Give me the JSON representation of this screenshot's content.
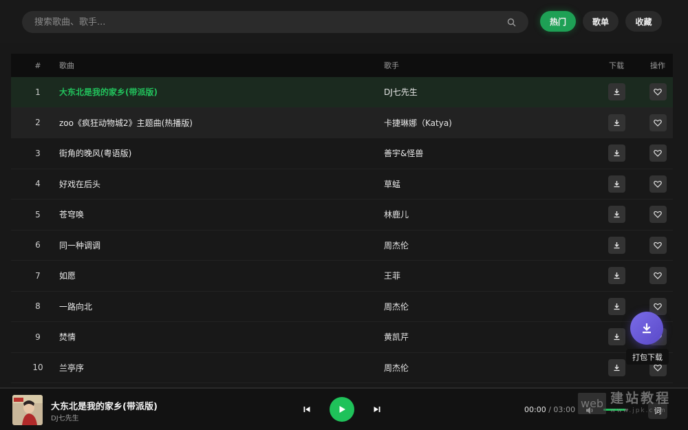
{
  "search": {
    "placeholder": "搜索歌曲、歌手..."
  },
  "tabs": [
    {
      "label": "热门",
      "active": true
    },
    {
      "label": "歌单",
      "active": false
    },
    {
      "label": "收藏",
      "active": false
    }
  ],
  "table": {
    "headers": {
      "num": "#",
      "title": "歌曲",
      "artist": "歌手",
      "download": "下载",
      "action": "操作"
    },
    "rows": [
      {
        "num": "1",
        "title": "大东北是我的家乡(带派版)",
        "artist": "DJ七先生"
      },
      {
        "num": "2",
        "title": "zoo《疯狂动物城2》主题曲(热播版)",
        "artist": "卡捷琳娜（Katya)"
      },
      {
        "num": "3",
        "title": "街角的晚风(粤语版)",
        "artist": "善宇&怪兽"
      },
      {
        "num": "4",
        "title": "好戏在后头",
        "artist": "草蜢"
      },
      {
        "num": "5",
        "title": "苍穹唤",
        "artist": "林鹿儿"
      },
      {
        "num": "6",
        "title": "同一种调调",
        "artist": "周杰伦"
      },
      {
        "num": "7",
        "title": "如愿",
        "artist": "王菲"
      },
      {
        "num": "8",
        "title": "一路向北",
        "artist": "周杰伦"
      },
      {
        "num": "9",
        "title": "焚情",
        "artist": "黄凯芹"
      },
      {
        "num": "10",
        "title": "兰亭序",
        "artist": "周杰伦"
      }
    ]
  },
  "fab": {
    "tooltip": "打包下载"
  },
  "player": {
    "title": "大东北是我的家乡(带派版)",
    "artist": "DJ七先生",
    "current_time": "00:00",
    "separator": "/",
    "total_time": "03:00",
    "volume": 0.9,
    "lyric_label": "词"
  },
  "watermark": {
    "box": "web",
    "text": "建站教程",
    "url": "www.jpk.com"
  },
  "colors": {
    "accent": "#1fc25a",
    "fab": "#6b5ce0",
    "background": "#181818"
  }
}
